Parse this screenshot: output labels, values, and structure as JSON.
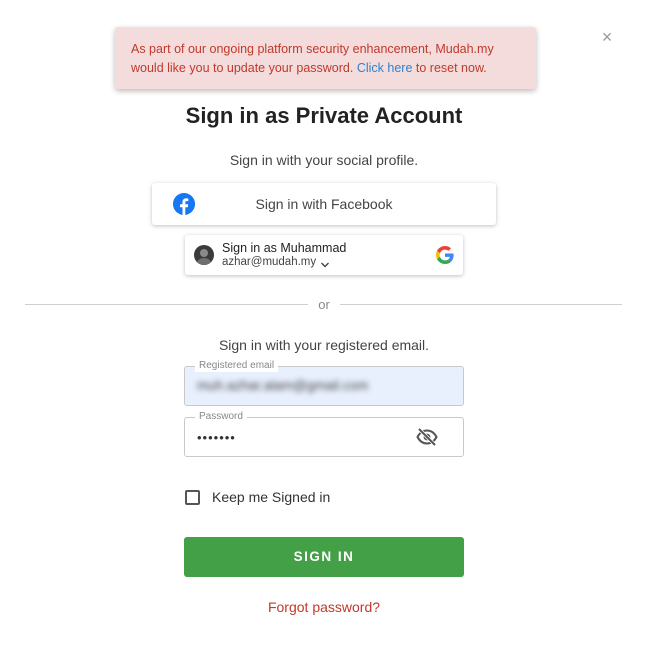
{
  "banner": {
    "text_before": "As part of our ongoing platform security enhancement, Mudah.my would like you to update your password. ",
    "link_text": "Click here",
    "text_after": " to reset now.",
    "text_color": "#c0392b",
    "link_color": "#2f80d1",
    "background": "#f4dcdc"
  },
  "close_icon": "×",
  "title": "Sign in as Private Account",
  "social_prompt": "Sign in with your social profile.",
  "facebook_button": {
    "label": "Sign in with Facebook",
    "icon": "facebook-icon",
    "brand_color": "#1877f2"
  },
  "google_button": {
    "name_line": "Sign in as Muhammad",
    "email_line": "azhar@mudah.my",
    "icon": "google-icon"
  },
  "divider_text": "or",
  "email_prompt": "Sign in with your registered email.",
  "email_field": {
    "legend": "Registered email",
    "value": "muh.azhar.alam@gmail.com"
  },
  "password_field": {
    "legend": "Password",
    "value": "•••••••",
    "toggle_icon": "eye-off-icon"
  },
  "keep_signed_in": {
    "label": "Keep me Signed in",
    "checked": false
  },
  "signin_button": {
    "label": "SIGN IN",
    "color": "#43a047"
  },
  "forgot_link": "Forgot password?"
}
